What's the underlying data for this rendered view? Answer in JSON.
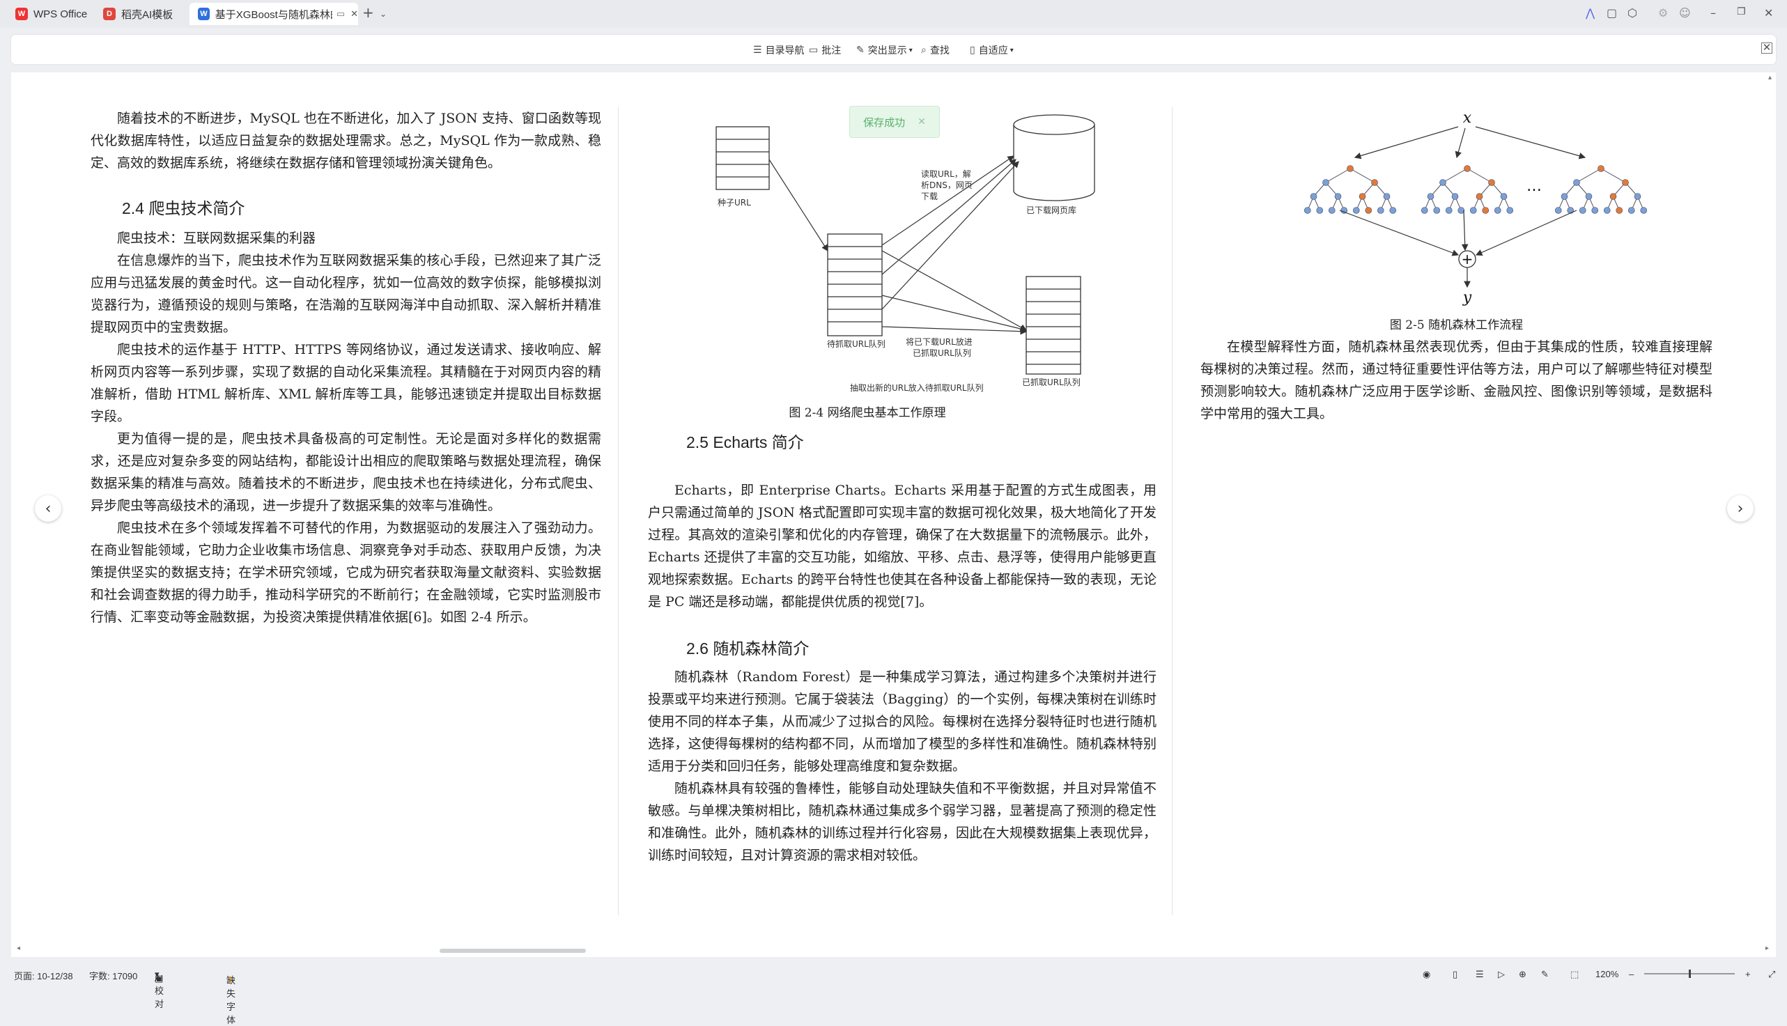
{
  "tabs": [
    {
      "label": "WPS Office",
      "icon": "W"
    },
    {
      "label": "稻壳AI模板",
      "icon": "D"
    },
    {
      "label": "基于XGBoost与随机森林的",
      "icon": "W"
    }
  ],
  "toolbar": {
    "toc": "目录导航",
    "comment": "批注",
    "highlight": "突出显示",
    "find": "查找",
    "fit": "自适应"
  },
  "toast": {
    "text": "保存成功"
  },
  "left_column": {
    "p_intro": "随着技术的不断进步，MySQL 也在不断进化，加入了 JSON 支持、窗口函数等现代化数据库特性，以适应日益复杂的数据处理需求。总之，MySQL 作为一款成熟、稳定、高效的数据库系统，将继续在数据存储和管理领域扮演关键角色。",
    "heading": "2.4  爬虫技术简介",
    "subtitle": "爬虫技术：互联网数据采集的利器",
    "p1": "在信息爆炸的当下，爬虫技术作为互联网数据采集的核心手段，已然迎来了其广泛应用与迅猛发展的黄金时代。这一自动化程序，犹如一位高效的数字侦探，能够模拟浏览器行为，遵循预设的规则与策略，在浩瀚的互联网海洋中自动抓取、深入解析并精准提取网页中的宝贵数据。",
    "p2": "爬虫技术的运作基于 HTTP、HTTPS 等网络协议，通过发送请求、接收响应、解析网页内容等一系列步骤，实现了数据的自动化采集流程。其精髓在于对网页内容的精准解析，借助 HTML 解析库、XML 解析库等工具，能够迅速锁定并提取出目标数据字段。",
    "p3": "更为值得一提的是，爬虫技术具备极高的可定制性。无论是面对多样化的数据需求，还是应对复杂多变的网站结构，都能设计出相应的爬取策略与数据处理流程，确保数据采集的精准与高效。随着技术的不断进步，爬虫技术也在持续进化，分布式爬虫、异步爬虫等高级技术的涌现，进一步提升了数据采集的效率与准确性。",
    "p4": "爬虫技术在多个领域发挥着不可替代的作用，为数据驱动的发展注入了强劲动力。在商业智能领域，它助力企业收集市场信息、洞察竞争对手动态、获取用户反馈，为决策提供坚实的数据支持；在学术研究领域，它成为研究者获取海量文献资料、实验数据和社会调查数据的得力助手，推动科学研究的不断前行；在金融领域，它实时监测股市行情、汇率变动等金融数据，为投资决策提供精准依据[6]。如图 2-4 所示。"
  },
  "middle_column": {
    "fig_labels": {
      "seed": "种子URL",
      "read1": "读取URL，解",
      "read2": "析DNS，网页",
      "read3": "下载",
      "downloaded": "已下载网页库",
      "todo": "待抓取URL队列",
      "move1": "将已下载URL放进",
      "move2": "已抓取URL队列",
      "crawled": "已抓取URL队列",
      "extract": "抽取出新的URL放入待抓取URL队列"
    },
    "fig_caption": "图 2-4      网络爬虫基本工作原理",
    "heading_echarts": "2.5 Echarts 简介",
    "p_echarts": "Echarts，即 Enterprise Charts。Echarts 采用基于配置的方式生成图表，用户只需通过简单的 JSON 格式配置即可实现丰富的数据可视化效果，极大地简化了开发过程。其高效的渲染引擎和优化的内存管理，确保了在大数据量下的流畅展示。此外，Echarts 还提供了丰富的交互功能，如缩放、平移、点击、悬浮等，使得用户能够更直观地探索数据。Echarts 的跨平台特性也使其在各种设备上都能保持一致的表现，无论是 PC 端还是移动端，都能提供优质的视觉[7]。",
    "heading_rf": "2.6  随机森林简介",
    "p_rf1": "随机森林（Random Forest）是一种集成学习算法，通过构建多个决策树并进行投票或平均来进行预测。它属于袋装法（Bagging）的一个实例，每棵决策树在训练时使用不同的样本子集，从而减少了过拟合的风险。每棵树在选择分裂特征时也进行随机选择，这使得每棵树的结构都不同，从而增加了模型的多样性和准确性。随机森林特别适用于分类和回归任务，能够处理高维度和复杂数据。",
    "p_rf2": "随机森林具有较强的鲁棒性，能够自动处理缺失值和不平衡数据，并且对异常值不敏感。与单棵决策树相比，随机森林通过集成多个弱学习器，显著提高了预测的稳定性和准确性。此外，随机森林的训练过程并行化容易，因此在大规模数据集上表现优异，训练时间较短，且对计算资源的需求相对较低。"
  },
  "right_column": {
    "fig_x": "x",
    "fig_y": "y",
    "fig_dots": "…",
    "fig_plus": "+",
    "fig_caption": "图 2-5  随机森林工作流程",
    "p": "在模型解释性方面，随机森林虽然表现优秀，但由于其集成的性质，较难直接理解每棵树的决策过程。然而，通过特征重要性评估等方法，用户可以了解哪些特征对模型预测影响较大。随机森林广泛应用于医学诊断、金融风控、图像识别等领域，是数据科学中常用的强大工具。"
  },
  "status": {
    "page": "页面: 10-12/38",
    "words": "字数: 17090",
    "ai": "AI 校对",
    "font": "缺失字体",
    "zoom": "120%"
  },
  "colors": {
    "accent": "#2f6fde",
    "toast_bg": "#e6f6e9",
    "toast_text": "#59b06c",
    "tree_orange": "#e07a3a",
    "tree_blue": "#7aa0d8"
  }
}
